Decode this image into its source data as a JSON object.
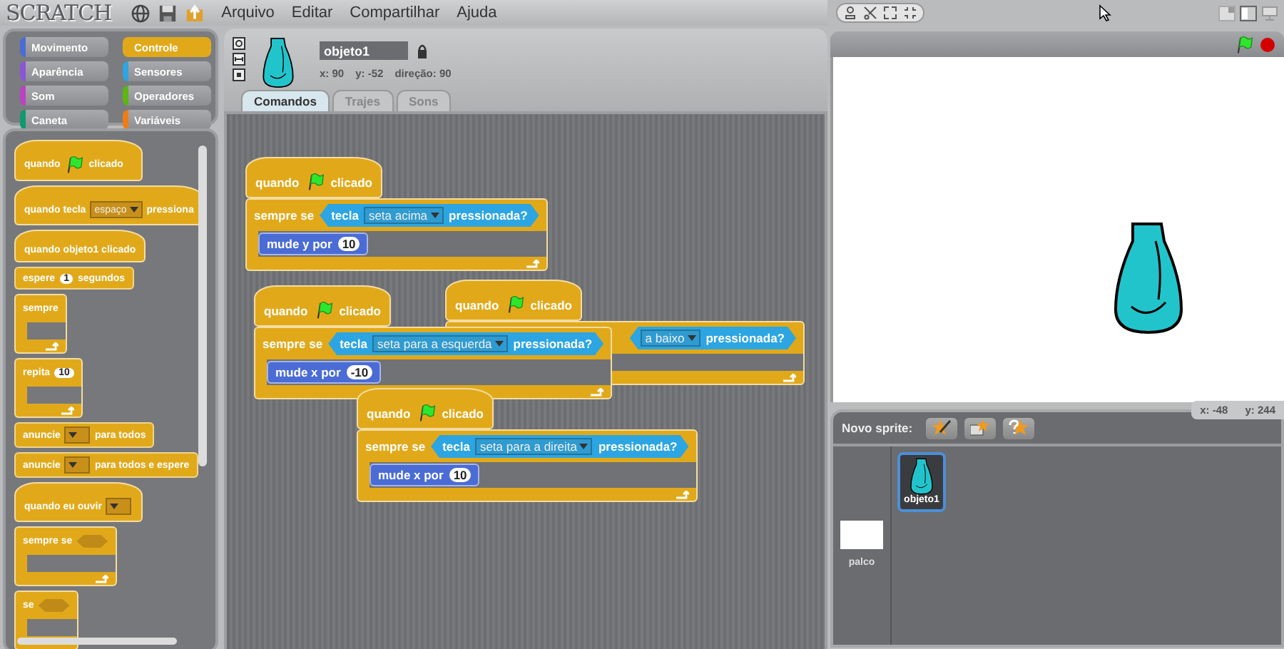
{
  "menu_bar": {
    "logo": "SCRATCH",
    "menus": [
      "Arquivo",
      "Editar",
      "Compartilhar",
      "Ajuda"
    ]
  },
  "categories": [
    {
      "label": "Movimento",
      "color": "#4a6cd4",
      "selected": false
    },
    {
      "label": "Aparência",
      "color": "#8a55d7",
      "selected": false
    },
    {
      "label": "Som",
      "color": "#bb42c3",
      "selected": false
    },
    {
      "label": "Caneta",
      "color": "#0e9a6c",
      "selected": false
    },
    {
      "label": "Controle",
      "color": "#e1a91a",
      "selected": true
    },
    {
      "label": "Sensores",
      "color": "#2ca5e2",
      "selected": false
    },
    {
      "label": "Operadores",
      "color": "#5cb712",
      "selected": false
    },
    {
      "label": "Variáveis",
      "color": "#ee7d16",
      "selected": false
    }
  ],
  "palette": [
    {
      "kind": "hat",
      "color": "#e1a91a",
      "parts": [
        {
          "kind": "text",
          "text": "quando"
        },
        {
          "kind": "flag"
        },
        {
          "kind": "text",
          "text": "clicado"
        }
      ]
    },
    {
      "kind": "hat",
      "color": "#e1a91a",
      "parts": [
        {
          "kind": "text",
          "text": "quando tecla"
        },
        {
          "kind": "dropdown",
          "text": "espaço"
        },
        {
          "kind": "text",
          "text": "pressiona"
        }
      ]
    },
    {
      "kind": "hat",
      "color": "#e1a91a",
      "parts": [
        {
          "kind": "text",
          "text": "quando objeto1 clicado"
        }
      ]
    },
    {
      "kind": "stack",
      "color": "#e1a91a",
      "parts": [
        {
          "kind": "text",
          "text": "espere"
        },
        {
          "kind": "number",
          "text": "1"
        },
        {
          "kind": "text",
          "text": "segundos"
        }
      ]
    },
    {
      "kind": "c",
      "color": "#e1a91a",
      "parts": [
        {
          "kind": "text",
          "text": "sempre"
        }
      ]
    },
    {
      "kind": "c",
      "color": "#e1a91a",
      "parts": [
        {
          "kind": "text",
          "text": "repita"
        },
        {
          "kind": "number",
          "text": "10"
        }
      ]
    },
    {
      "kind": "stack",
      "color": "#e1a91a",
      "parts": [
        {
          "kind": "text",
          "text": "anuncie"
        },
        {
          "kind": "dropdown"
        },
        {
          "kind": "text",
          "text": "para todos"
        }
      ]
    },
    {
      "kind": "stack",
      "color": "#e1a91a",
      "parts": [
        {
          "kind": "text",
          "text": "anuncie"
        },
        {
          "kind": "dropdown"
        },
        {
          "kind": "text",
          "text": "para todos e espere"
        }
      ]
    },
    {
      "kind": "hat",
      "color": "#e1a91a",
      "parts": [
        {
          "kind": "text",
          "text": "quando eu ouvir"
        },
        {
          "kind": "dropdown"
        }
      ]
    },
    {
      "kind": "c",
      "color": "#e1a91a",
      "parts": [
        {
          "kind": "text",
          "text": "sempre se"
        },
        {
          "kind": "slot"
        }
      ]
    },
    {
      "kind": "if",
      "color": "#e1a91a",
      "parts": [
        {
          "kind": "text",
          "text": "se"
        },
        {
          "kind": "slot"
        }
      ]
    }
  ],
  "sprite": {
    "name": "objeto1",
    "x": "x: 90",
    "y": "y: -52",
    "direction": "direção: 90"
  },
  "tabs": [
    {
      "label": "Comandos",
      "selected": true
    },
    {
      "label": "Trajes",
      "selected": false
    },
    {
      "label": "Sons",
      "selected": false
    }
  ],
  "scripts": [
    [
      {
        "kind": "hat",
        "color": "#e1a91a",
        "parts": [
          {
            "kind": "text",
            "text": "quando"
          },
          {
            "kind": "flag"
          },
          {
            "kind": "text",
            "text": "clicado"
          }
        ]
      },
      {
        "kind": "c",
        "color": "#e1a91a",
        "parts": [
          {
            "kind": "text",
            "text": "sempre se"
          },
          {
            "kind": "boolean",
            "parts": [
              {
                "kind": "text",
                "text": "tecla"
              },
              {
                "kind": "dropdown",
                "text": "seta acima"
              },
              {
                "kind": "text",
                "text": "pressionada?"
              }
            ]
          }
        ],
        "inner": [
          {
            "kind": "stack",
            "color": "#4a6cd4",
            "parts": [
              {
                "kind": "text",
                "text": "mude y por"
              },
              {
                "kind": "number",
                "text": "10"
              }
            ]
          }
        ]
      }
    ],
    [
      {
        "kind": "hat",
        "color": "#e1a91a",
        "parts": [
          {
            "kind": "text",
            "text": "quando"
          },
          {
            "kind": "flag"
          },
          {
            "kind": "text",
            "text": "clicado"
          }
        ]
      },
      {
        "kind": "c",
        "color": "#e1a91a",
        "parts": [
          {
            "kind": "text",
            "text": "sempre se"
          },
          {
            "kind": "boolean",
            "parts": [
              {
                "kind": "text",
                "text": "tecla"
              },
              {
                "kind": "dropdown",
                "text": "seta para a esquerda"
              },
              {
                "kind": "text",
                "text": "pressionada?"
              }
            ]
          }
        ],
        "inner": [
          {
            "kind": "stack",
            "color": "#4a6cd4",
            "parts": [
              {
                "kind": "text",
                "text": "mude x por"
              },
              {
                "kind": "number",
                "text": "-10"
              }
            ]
          }
        ]
      }
    ],
    [
      {
        "kind": "hat",
        "color": "#e1a91a",
        "parts": [
          {
            "kind": "text",
            "text": "quando"
          },
          {
            "kind": "flag"
          },
          {
            "kind": "text",
            "text": "clicado"
          }
        ]
      },
      {
        "kind": "c",
        "color": "#e1a91a",
        "parts": [
          {
            "kind": "boolean",
            "parts": [
              {
                "kind": "dropdown",
                "text": "a baixo"
              },
              {
                "kind": "text",
                "text": "pressionada?"
              }
            ]
          }
        ]
      }
    ],
    [
      {
        "kind": "hat",
        "color": "#e1a91a",
        "parts": [
          {
            "kind": "text",
            "text": "quando"
          },
          {
            "kind": "flag"
          },
          {
            "kind": "text",
            "text": "clicado"
          }
        ]
      },
      {
        "kind": "c",
        "color": "#e1a91a",
        "parts": [
          {
            "kind": "text",
            "text": "sempre se"
          },
          {
            "kind": "boolean",
            "parts": [
              {
                "kind": "text",
                "text": "tecla"
              },
              {
                "kind": "dropdown",
                "text": "seta para a direita"
              },
              {
                "kind": "text",
                "text": "pressionada?"
              }
            ]
          }
        ],
        "inner": [
          {
            "kind": "stack",
            "color": "#4a6cd4",
            "parts": [
              {
                "kind": "text",
                "text": "mude x por"
              },
              {
                "kind": "number",
                "text": "10"
              }
            ]
          }
        ]
      }
    ]
  ],
  "sprite_panel": {
    "label": "Novo sprite:",
    "mouse_x": "x: -48",
    "mouse_y": "y: 244",
    "stage_label": "palco",
    "sprites": [
      {
        "name": "objeto1",
        "selected": true
      }
    ]
  }
}
